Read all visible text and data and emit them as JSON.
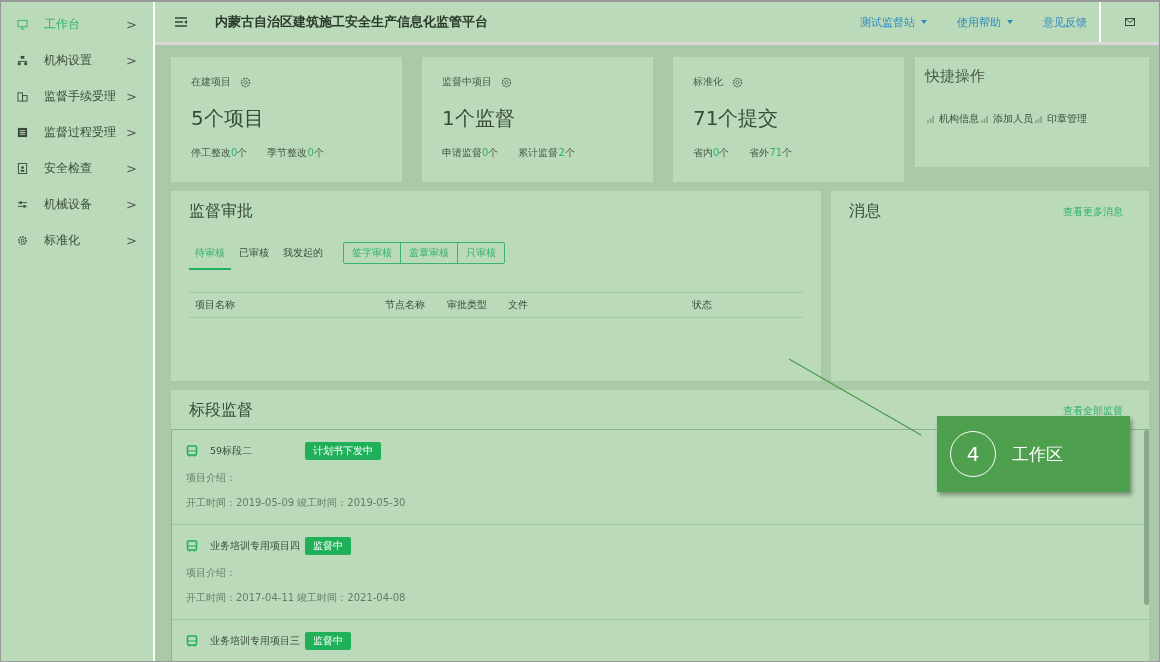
{
  "sidebar": {
    "items": [
      {
        "label": "工作台",
        "selected": true
      },
      {
        "label": "机构设置",
        "selected": false
      },
      {
        "label": "监督手续受理",
        "selected": false
      },
      {
        "label": "监督过程受理",
        "selected": false
      },
      {
        "label": "安全检查",
        "selected": false
      },
      {
        "label": "机械设备",
        "selected": false
      },
      {
        "label": "标准化",
        "selected": false
      }
    ],
    "chevron": ">"
  },
  "header": {
    "title": "内蒙古自治区建筑施工安全生产信息化监管平台",
    "links": [
      {
        "label": "测试监督站",
        "dropdown": true
      },
      {
        "label": "使用帮助",
        "dropdown": true
      },
      {
        "label": "意见反馈",
        "dropdown": false
      }
    ]
  },
  "stats": [
    {
      "title": "在建项目",
      "value": "5个项目",
      "items": [
        {
          "label": "停工整改",
          "count": "0",
          "unit": "个"
        },
        {
          "label": "季节整改",
          "count": "0",
          "unit": "个"
        }
      ]
    },
    {
      "title": "监督中项目",
      "value": "1个监督",
      "items": [
        {
          "label": "申请监督",
          "count": "0",
          "unit": "个"
        },
        {
          "label": "累计监督",
          "count": "2",
          "unit": "个"
        }
      ]
    },
    {
      "title": "标准化",
      "value": "71个提交",
      "items": [
        {
          "label": "省内",
          "count": "0",
          "unit": "个"
        },
        {
          "label": "省外",
          "count": "71",
          "unit": "个"
        }
      ]
    }
  ],
  "quick_actions": {
    "title": "快捷操作",
    "items": [
      "机构信息",
      "添加人员",
      "印章管理"
    ]
  },
  "approval": {
    "title": "监督审批",
    "tabs": [
      {
        "label": "待审核",
        "selected": true
      },
      {
        "label": "已审核",
        "selected": false
      },
      {
        "label": "我发起的",
        "selected": false
      }
    ],
    "filters": [
      "签字审核",
      "盖章审核",
      "只审核"
    ],
    "columns": [
      "项目名称",
      "节点名称",
      "审批类型",
      "文件",
      "状态"
    ]
  },
  "messages": {
    "title": "消息",
    "link": "查看更多消息"
  },
  "sections": {
    "title": "标段监督",
    "link": "查看全部监督",
    "items": [
      {
        "name": "59标段二",
        "status": "计划书下发中",
        "intro": "项目介绍：",
        "dates": "开工时间：2019-05-09 竣工时间：2019-05-30"
      },
      {
        "name": "业务培训专用项目四",
        "status": "监督中",
        "intro": "项目介绍：",
        "dates": "开工时间：2017-04-11 竣工时间：2021-04-08"
      },
      {
        "name": "业务培训专用项目三",
        "status": "监督中"
      }
    ]
  },
  "callout": {
    "number": "4",
    "label": "工作区"
  }
}
